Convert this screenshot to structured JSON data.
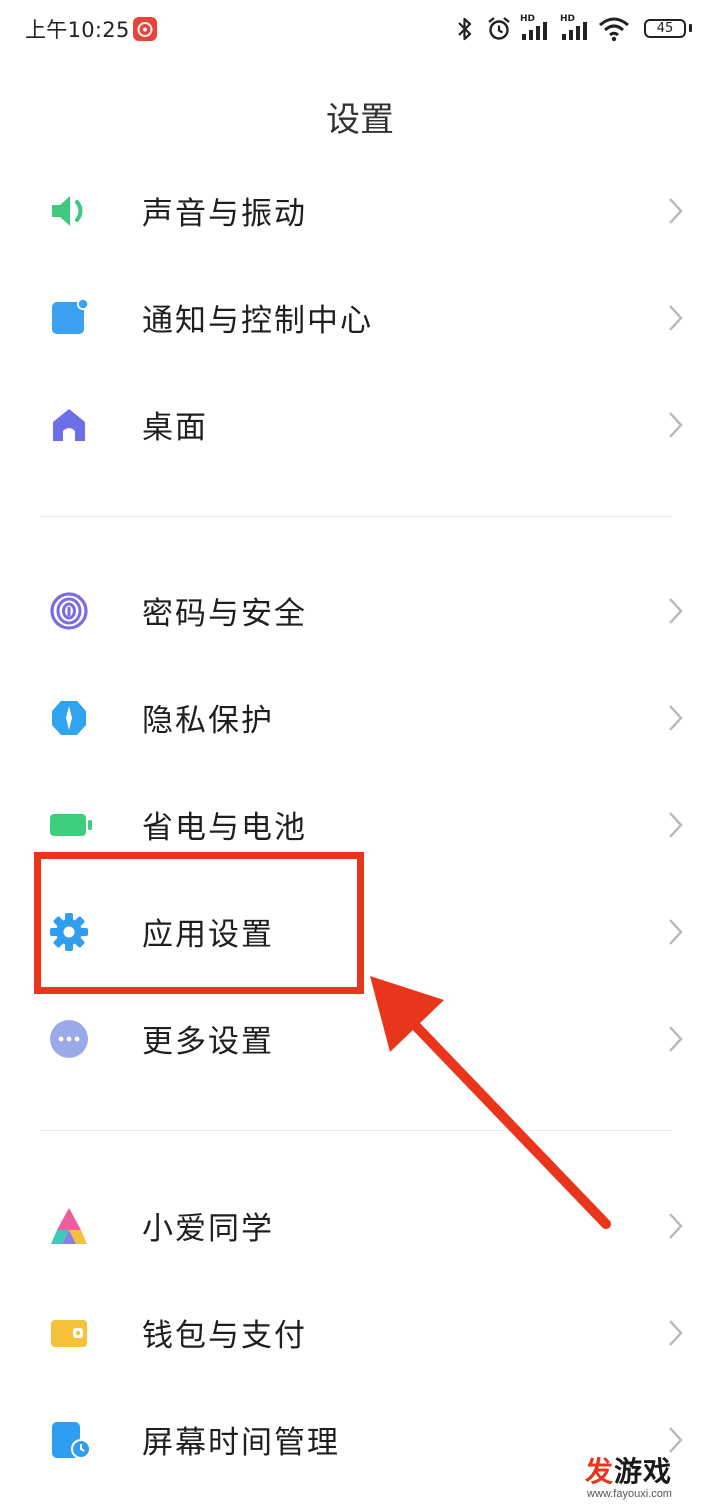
{
  "status_bar": {
    "time": "上午10:25",
    "battery": "45",
    "hd_label": "HD"
  },
  "title": "设置",
  "groups": [
    {
      "items": [
        {
          "label": "声音与振动",
          "icon": "speaker-icon",
          "color": "#3ec97e"
        },
        {
          "label": "通知与控制中心",
          "icon": "notification-icon",
          "color": "#3aa0f2"
        },
        {
          "label": "桌面",
          "icon": "home-icon",
          "color": "#6d6ee8"
        }
      ]
    },
    {
      "items": [
        {
          "label": "密码与安全",
          "icon": "fingerprint-icon",
          "color": "#7a6ce6"
        },
        {
          "label": "隐私保护",
          "icon": "privacy-shield-icon",
          "color": "#2fa4ee"
        },
        {
          "label": "省电与电池",
          "icon": "battery-icon",
          "color": "#3ecf7e"
        },
        {
          "label": "应用设置",
          "icon": "gear-icon",
          "color": "#2f9ef0"
        },
        {
          "label": "更多设置",
          "icon": "more-dots-icon",
          "color": "#9aaae8"
        }
      ]
    },
    {
      "items": [
        {
          "label": "小爱同学",
          "icon": "xiaoai-icon",
          "color": "#f05aa0"
        },
        {
          "label": "钱包与支付",
          "icon": "wallet-icon",
          "color": "#f6c23a"
        },
        {
          "label": "屏幕时间管理",
          "icon": "screen-time-icon",
          "color": "#2f9ef0"
        }
      ]
    }
  ],
  "annotation": {
    "color": "#e8351c",
    "target": "应用设置"
  },
  "watermark": {
    "brand_first": "发",
    "brand_rest": "游戏",
    "url": "www.fayouxi.com"
  }
}
